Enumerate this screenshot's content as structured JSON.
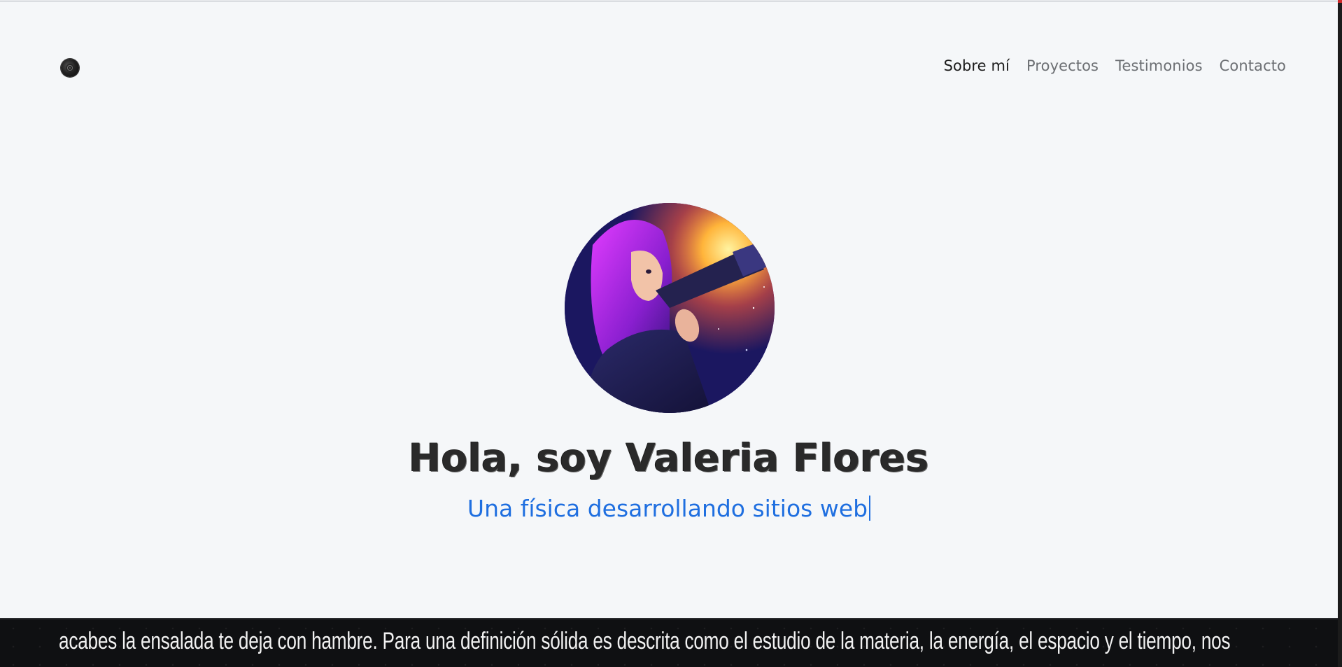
{
  "nav": {
    "logo_icon": "planet-logo-icon",
    "links": [
      {
        "label": "Sobre mí",
        "active": true
      },
      {
        "label": "Proyectos",
        "active": false
      },
      {
        "label": "Testimonios",
        "active": false
      },
      {
        "label": "Contacto",
        "active": false
      }
    ]
  },
  "hero": {
    "avatar_icon": "astronomer-avatar-illustration",
    "title": "Hola, soy Valeria Flores",
    "subtitle": "Una física desarrollando sitios web"
  },
  "marquee": {
    "text": "acabes la ensalada te deja con hambre. Para una definición sólida es descrita como el estudio de la materia, la energía, el espacio y el tiempo, nos"
  },
  "colors": {
    "background": "#f5f7f9",
    "accent": "#1f6fe0",
    "nav_active": "#1c1c1c",
    "nav_inactive": "#6c6f73",
    "marquee_bg": "#0f1012"
  }
}
